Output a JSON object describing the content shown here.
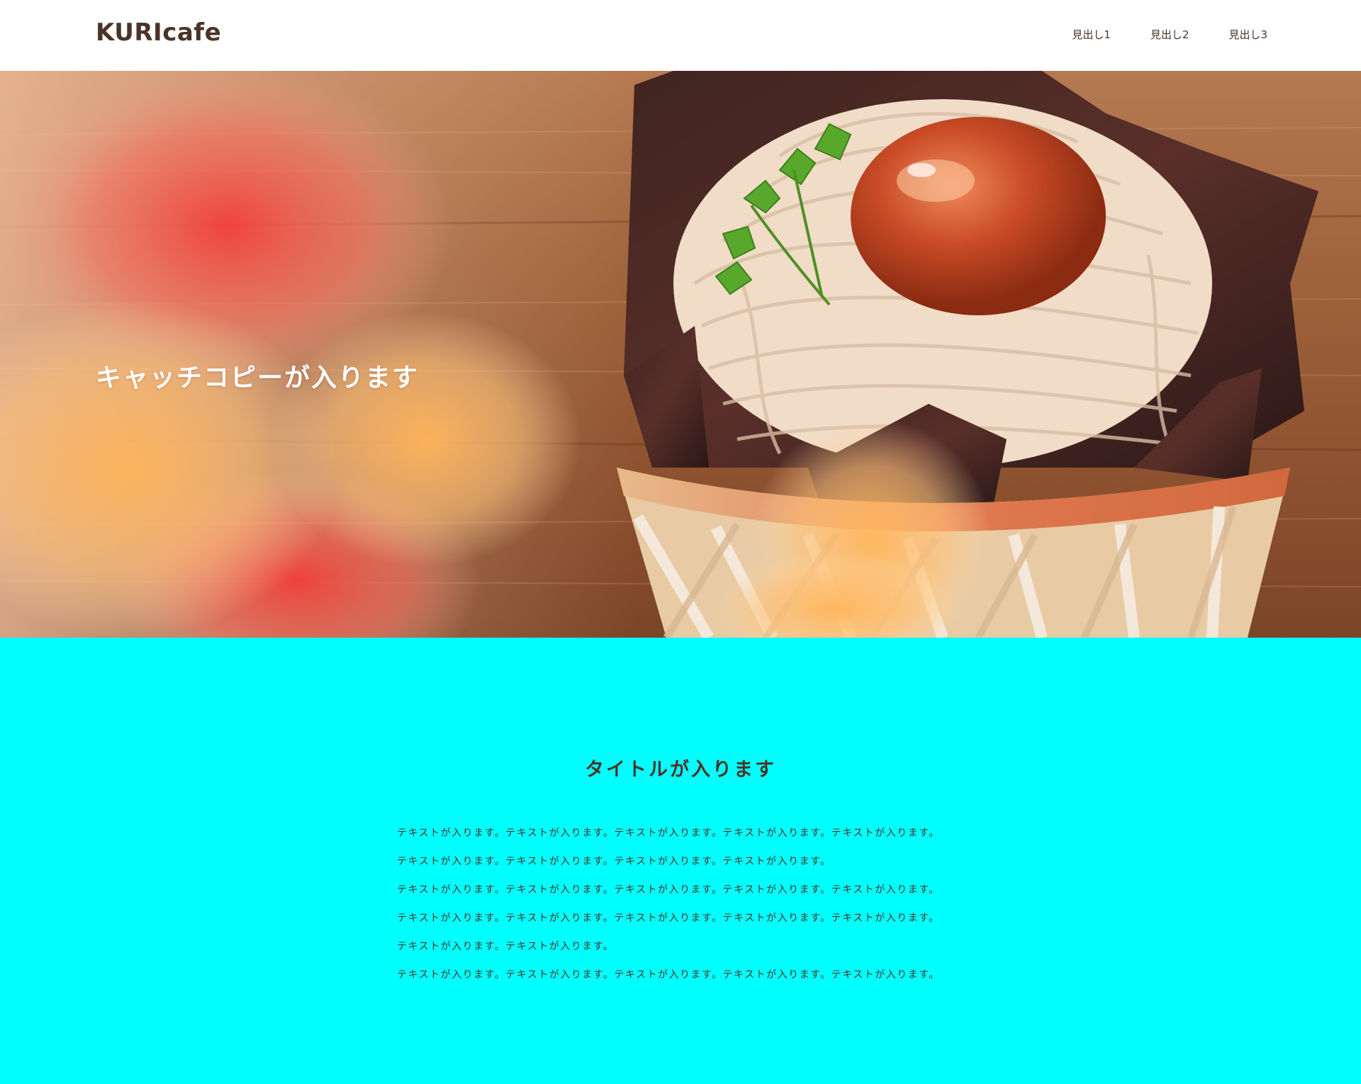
{
  "header": {
    "logo": "KURIcafe",
    "nav": [
      "見出し1",
      "見出し2",
      "見出し3"
    ]
  },
  "hero": {
    "catchcopy": "キャッチコピーが入ります",
    "image_subject": "chestnut mont blanc cake in a woven basket on a wooden table"
  },
  "about": {
    "title": "タイトルが入ります",
    "paragraphs": [
      "テキストが入ります。テキストが入ります。テキストが入ります。テキストが入ります。テキストが入ります。",
      "テキストが入ります。テキストが入ります。テキストが入ります。テキストが入ります。",
      "テキストが入ります。テキストが入ります。テキストが入ります。テキストが入ります。テキストが入ります。",
      "テキストが入ります。テキストが入ります。テキストが入ります。テキストが入ります。テキストが入ります。",
      "テキストが入ります。テキストが入ります。",
      "テキストが入ります。テキストが入ります。テキストが入ります。テキストが入ります。テキストが入ります。"
    ]
  },
  "colors": {
    "brand_text": "#4a3428",
    "section_bg": "#00ffff",
    "header_bg": "#ffffff",
    "hero_text": "#ffffff"
  }
}
